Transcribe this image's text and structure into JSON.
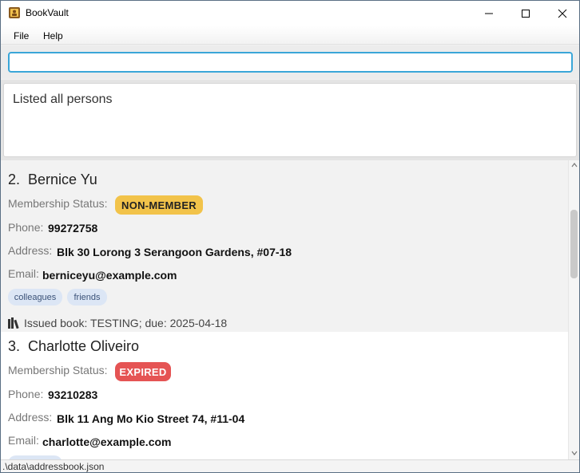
{
  "window": {
    "title": "BookVault"
  },
  "menu": {
    "items": [
      {
        "label": "File"
      },
      {
        "label": "Help"
      }
    ]
  },
  "command": {
    "value": "",
    "placeholder": ""
  },
  "result": {
    "message": "Listed all persons"
  },
  "persons": [
    {
      "index": "2.",
      "name": "Bernice Yu",
      "membership_label": "Membership Status:",
      "membership_status": "NON-MEMBER",
      "membership_color": "#f2c34a",
      "phone_label": "Phone:",
      "phone": "99272758",
      "address_label": "Address:",
      "address": "Blk 30 Lorong 3 Serangoon Gardens, #07-18",
      "email_label": "Email:",
      "email": "berniceyu@example.com",
      "tags": [
        "colleagues",
        "friends"
      ],
      "issued": "Issued book: TESTING; due: 2025-04-18"
    },
    {
      "index": "3.",
      "name": "Charlotte Oliveiro",
      "membership_label": "Membership Status:",
      "membership_status": "EXPIRED",
      "membership_color": "#e55454",
      "phone_label": "Phone:",
      "phone": "93210283",
      "address_label": "Address:",
      "address": "Blk 11 Ang Mo Kio Street 74, #11-04",
      "email_label": "Email:",
      "email": "charlotte@example.com"
    }
  ],
  "status": {
    "path": ".\\data\\addressbook.json"
  }
}
